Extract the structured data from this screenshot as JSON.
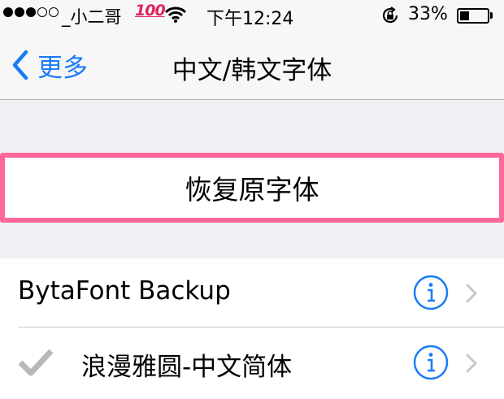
{
  "status_bar": {
    "carrier": "_小二哥",
    "emoji_badge": "100",
    "time": "下午12:24",
    "battery_percent": "33%",
    "battery_level": 0.33,
    "signal_strength": 3,
    "signal_max": 5
  },
  "nav": {
    "back_label": "更多",
    "title": "中文/韩文字体"
  },
  "restore": {
    "label": "恢复原字体"
  },
  "fonts": [
    {
      "label": "BytaFont Backup",
      "checked": false
    },
    {
      "label": "浪漫雅圆-中文简体",
      "checked": true
    }
  ],
  "colors": {
    "accent": "#1a7cf5",
    "highlight": "#ff6699",
    "checkmark": "#b8b8b8"
  }
}
